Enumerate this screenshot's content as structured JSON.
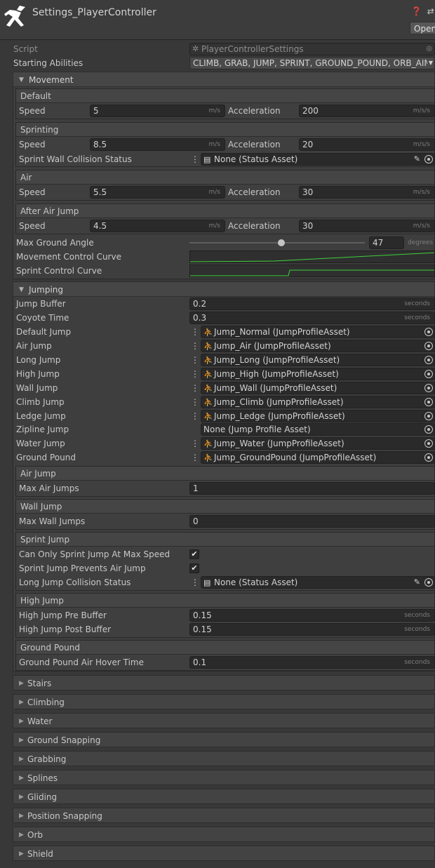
{
  "header": {
    "title": "Settings_PlayerController",
    "icons": "❓ ⇄ ⋮",
    "open_label": "Open"
  },
  "script": {
    "label": "Script",
    "value": "PlayerControllerSettings"
  },
  "starting_abilities": {
    "label": "Starting Abilities",
    "value": "CLIMB, GRAB, JUMP, SPRINT, GROUND_POUND, ORB_AIM"
  },
  "movement": {
    "title": "Movement",
    "default": {
      "title": "Default",
      "speed_label": "Speed",
      "speed": "5",
      "speed_unit": "m/s",
      "accel_label": "Acceleration",
      "accel": "200",
      "accel_unit": "m/s/s"
    },
    "sprinting": {
      "title": "Sprinting",
      "speed_label": "Speed",
      "speed": "8.5",
      "speed_unit": "m/s",
      "accel_label": "Acceleration",
      "accel": "20",
      "accel_unit": "m/s/s",
      "wall_label": "Sprint Wall Collision Status",
      "wall_value": "None (Status Asset)"
    },
    "air": {
      "title": "Air",
      "speed_label": "Speed",
      "speed": "5.5",
      "speed_unit": "m/s",
      "accel_label": "Acceleration",
      "accel": "30",
      "accel_unit": "m/s/s"
    },
    "after_air_jump": {
      "title": "After Air Jump",
      "speed_label": "Speed",
      "speed": "4.5",
      "speed_unit": "m/s",
      "accel_label": "Acceleration",
      "accel": "30",
      "accel_unit": "m/s/s"
    },
    "max_ground_angle_label": "Max Ground Angle",
    "max_ground_angle": "47",
    "max_ground_angle_unit": "degrees",
    "movement_curve_label": "Movement Control Curve",
    "sprint_curve_label": "Sprint Control Curve"
  },
  "jumping": {
    "title": "Jumping",
    "jump_buffer_label": "Jump Buffer",
    "jump_buffer": "0.2",
    "jump_buffer_unit": "seconds",
    "coyote_label": "Coyote Time",
    "coyote": "0.3",
    "coyote_unit": "seconds",
    "profiles": [
      {
        "label": "Default Jump",
        "value": "Jump_Normal (JumpProfileAsset)"
      },
      {
        "label": "Air Jump",
        "value": "Jump_Air (JumpProfileAsset)"
      },
      {
        "label": "Long Jump",
        "value": "Jump_Long (JumpProfileAsset)"
      },
      {
        "label": "High Jump",
        "value": "Jump_High (JumpProfileAsset)"
      },
      {
        "label": "Wall Jump",
        "value": "Jump_Wall (JumpProfileAsset)"
      },
      {
        "label": "Climb Jump",
        "value": "Jump_Climb (JumpProfileAsset)"
      },
      {
        "label": "Ledge Jump",
        "value": "Jump_Ledge (JumpProfileAsset)"
      },
      {
        "label": "Zipline Jump",
        "value": "None (Jump Profile Asset)"
      },
      {
        "label": "Water Jump",
        "value": "Jump_Water (JumpProfileAsset)"
      },
      {
        "label": "Ground Pound",
        "value": "Jump_GroundPound (JumpProfileAsset)"
      }
    ],
    "air_jump": {
      "title": "Air Jump",
      "label": "Max Air Jumps",
      "value": "1"
    },
    "wall_jump": {
      "title": "Wall Jump",
      "label": "Max Wall Jumps",
      "value": "0"
    },
    "sprint_jump": {
      "title": "Sprint Jump",
      "only_max_label": "Can Only Sprint Jump At Max Speed",
      "only_max": "✔",
      "prevents_air_label": "Sprint Jump Prevents Air Jump",
      "prevents_air": "✔",
      "collision_label": "Long Jump Collision Status",
      "collision_value": "None (Status Asset)"
    },
    "high_jump": {
      "title": "High Jump",
      "pre_label": "High Jump Pre Buffer",
      "pre": "0.15",
      "post_label": "High Jump Post Buffer",
      "post": "0.15",
      "unit": "seconds"
    },
    "ground_pound": {
      "title": "Ground Pound",
      "label": "Ground Pound Air Hover Time",
      "value": "0.1",
      "unit": "seconds"
    }
  },
  "collapsed_sections": [
    "Stairs",
    "Climbing",
    "Water",
    "Ground Snapping",
    "Grabbing",
    "Splines",
    "Gliding",
    "Position Snapping",
    "Orb",
    "Shield"
  ],
  "colors": {
    "curve": "#3dd13d"
  }
}
